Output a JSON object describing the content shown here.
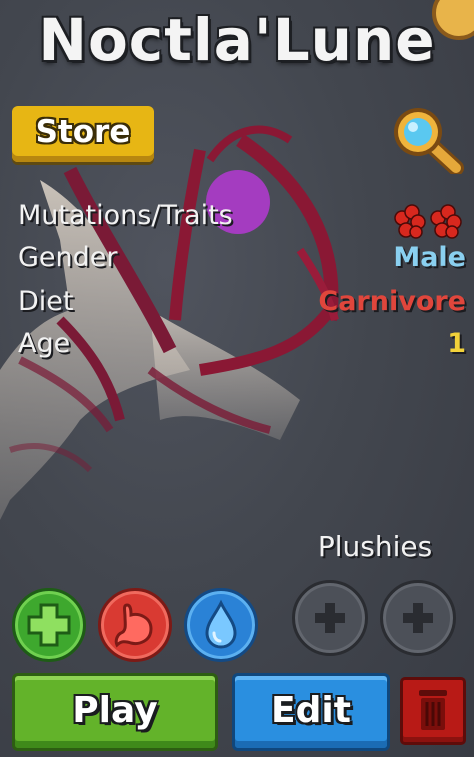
{
  "header": {
    "title": "Noctla'Lune"
  },
  "toolbar": {
    "store_label": "Store",
    "search_icon": "magnifier-icon"
  },
  "stats": {
    "mutations": {
      "label": "Mutations/Traits",
      "icon": "trait-clusters-icon"
    },
    "gender": {
      "label": "Gender",
      "value": "Male",
      "color": "#8ad0f0"
    },
    "diet": {
      "label": "Diet",
      "value": "Carnivore",
      "color": "#e0463c"
    },
    "age": {
      "label": "Age",
      "value": "1",
      "color": "#f2d23a"
    }
  },
  "plushies": {
    "label": "Plushies",
    "slots": [
      "empty",
      "empty"
    ]
  },
  "needs": [
    {
      "name": "health",
      "icon": "plus-icon",
      "color": "#3ea82e"
    },
    {
      "name": "hunger",
      "icon": "stomach-icon",
      "color": "#d93a32"
    },
    {
      "name": "thirst",
      "icon": "water-drop-icon",
      "color": "#2a82d6"
    }
  ],
  "actions": {
    "play_label": "Play",
    "edit_label": "Edit",
    "delete_icon": "trash-icon"
  }
}
